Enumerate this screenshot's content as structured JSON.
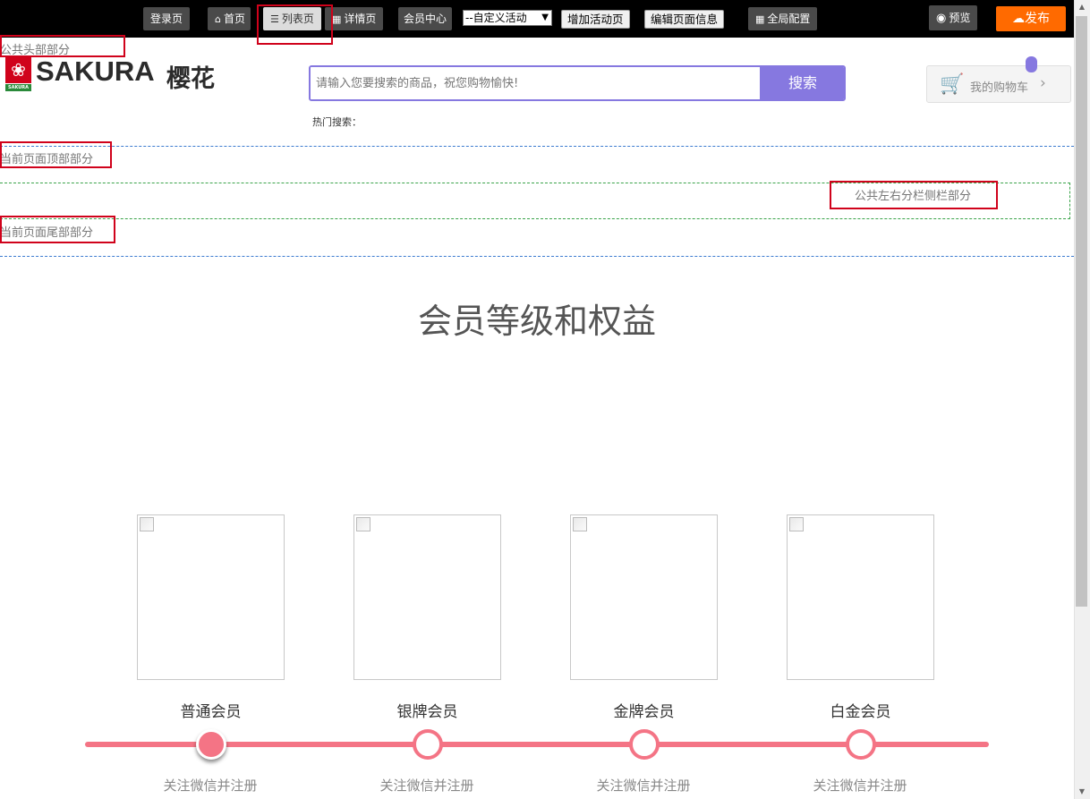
{
  "toolbar": {
    "login_label": "登录页",
    "home_label": "首页",
    "list_label": "列表页",
    "detail_label": "详情页",
    "member_center_label": "会员中心",
    "activity_select_value": "--自定义活动",
    "add_activity_label": "增加活动页",
    "edit_page_label": "编辑页面信息",
    "global_config_label": "全局配置",
    "preview_label": "预览",
    "publish_label": "发布"
  },
  "header": {
    "region_label": "公共头部部分",
    "logo_text": "SAKURA",
    "logo_cn": "樱花",
    "logo_strip_text": "SAKURA",
    "search": {
      "placeholder": "请输入您要搜索的商品，祝您购物愉快!",
      "button_label": "搜索"
    },
    "hot_search_label": "热门搜索：",
    "cart_label": "我的购物车"
  },
  "regions": {
    "page_top_label": "当前页面顶部部分",
    "sidebar_label": "公共左右分栏侧栏部分",
    "page_bottom_label": "当前页面尾部部分"
  },
  "main": {
    "title": "会员等级和权益",
    "tiers": [
      {
        "name": "普通会员",
        "desc": "关注微信并注册"
      },
      {
        "name": "银牌会员",
        "desc": "关注微信并注册"
      },
      {
        "name": "金牌会员",
        "desc": "关注微信并注册"
      },
      {
        "name": "白金会员",
        "desc": "关注微信并注册"
      }
    ]
  },
  "colors": {
    "accent": "#8678e0",
    "publish": "#ff6a00",
    "timeline": "#f47485",
    "highlight": "#d0021b"
  }
}
